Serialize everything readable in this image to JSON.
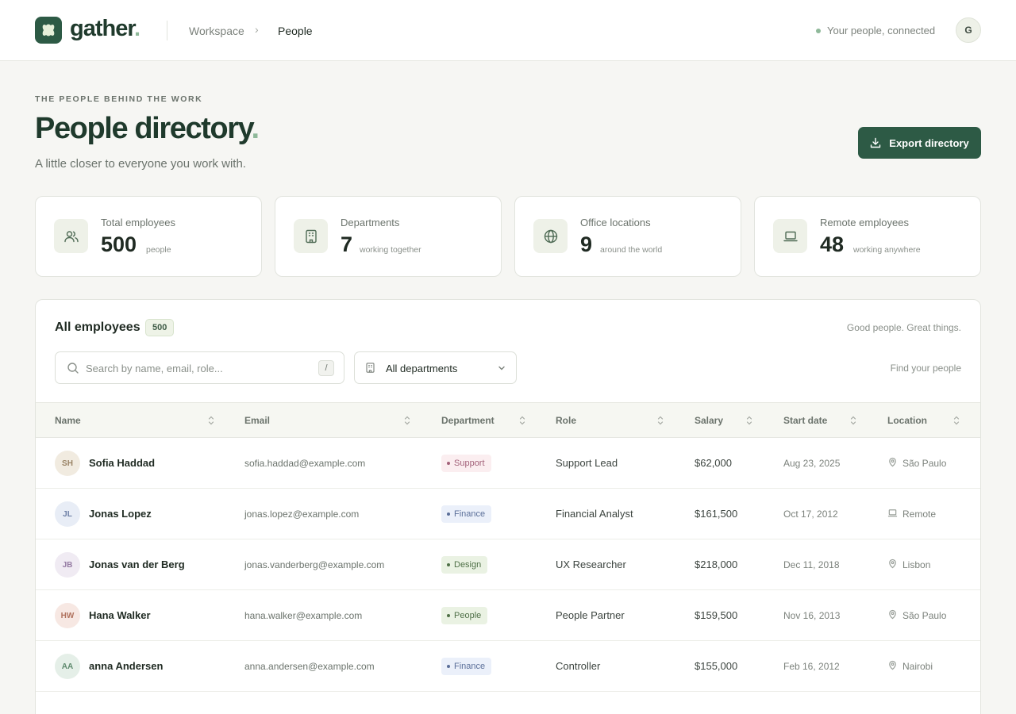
{
  "header": {
    "logo_text": "gather",
    "logo_dot": ".",
    "breadcrumb": [
      "Workspace",
      "People"
    ],
    "breadcrumb_sep": "›",
    "status": "Your people, connected",
    "user_initial": "G"
  },
  "hero": {
    "eyebrow": "THE PEOPLE BEHIND THE WORK",
    "title": "People directory",
    "title_dot": ".",
    "subtitle": "A little closer to everyone you work with.",
    "export_label": "Export directory"
  },
  "stats": [
    {
      "label": "Total employees",
      "value": "500",
      "unit": "people",
      "icon": "users-icon"
    },
    {
      "label": "Departments",
      "value": "7",
      "unit": "working together",
      "icon": "building-icon"
    },
    {
      "label": "Office locations",
      "value": "9",
      "unit": "around the world",
      "icon": "globe-icon"
    },
    {
      "label": "Remote employees",
      "value": "48",
      "unit": "working anywhere",
      "icon": "laptop-icon"
    }
  ],
  "table": {
    "title": "All employees",
    "count": "500",
    "tagline": "Good people. Great things.",
    "search_placeholder": "Search by name, email, role...",
    "search_shortcut": "/",
    "department_filter": "All departments",
    "hint": "Find your people",
    "columns": [
      "Name",
      "Email",
      "Department",
      "Role",
      "Salary",
      "Start date",
      "Location"
    ],
    "rows": [
      {
        "initials": "SH",
        "name": "Sofia Haddad",
        "email": "sofia.haddad@example.com",
        "department": "Support",
        "role": "Support Lead",
        "salary": "$62,000",
        "start": "Aug 23, 2025",
        "location": "São Paulo",
        "loc_icon": "map-pin-icon",
        "av_bg": "#f1ebe0",
        "av_fg": "#9a8466",
        "d_bg": "#fbeef0",
        "d_fg": "#a3627a"
      },
      {
        "initials": "JL",
        "name": "Jonas Lopez",
        "email": "jonas.lopez@example.com",
        "department": "Finance",
        "role": "Financial Analyst",
        "salary": "$161,500",
        "start": "Oct 17, 2012",
        "location": "Remote",
        "loc_icon": "laptop-icon",
        "av_bg": "#e8edf6",
        "av_fg": "#6d7fa6",
        "d_bg": "#ebf0fa",
        "d_fg": "#5b6f99"
      },
      {
        "initials": "JB",
        "name": "Jonas van der Berg",
        "email": "jonas.vanderberg@example.com",
        "department": "Design",
        "role": "UX Researcher",
        "salary": "$218,000",
        "start": "Dec 11, 2018",
        "location": "Lisbon",
        "loc_icon": "map-pin-icon",
        "av_bg": "#f0ebf3",
        "av_fg": "#957ba3",
        "d_bg": "#eaf2e3",
        "d_fg": "#4f7047"
      },
      {
        "initials": "HW",
        "name": "Hana Walker",
        "email": "hana.walker@example.com",
        "department": "People",
        "role": "People Partner",
        "salary": "$159,500",
        "start": "Nov 16, 2013",
        "location": "São Paulo",
        "loc_icon": "map-pin-icon",
        "av_bg": "#f7e8e3",
        "av_fg": "#b0725e",
        "d_bg": "#eaf2e3",
        "d_fg": "#4f7047"
      },
      {
        "initials": "AA",
        "name": "anna Andersen",
        "email": "anna.andersen@example.com",
        "department": "Finance",
        "role": "Controller",
        "salary": "$155,000",
        "start": "Feb 16, 2012",
        "location": "Nairobi",
        "loc_icon": "map-pin-icon",
        "av_bg": "#e5efe8",
        "av_fg": "#5f8a6e",
        "d_bg": "#ebf0fa",
        "d_fg": "#5b6f99"
      }
    ]
  },
  "colors": {
    "brand": "#2d5a45",
    "accent": "#8fb99a",
    "background": "#f6f6f3"
  }
}
